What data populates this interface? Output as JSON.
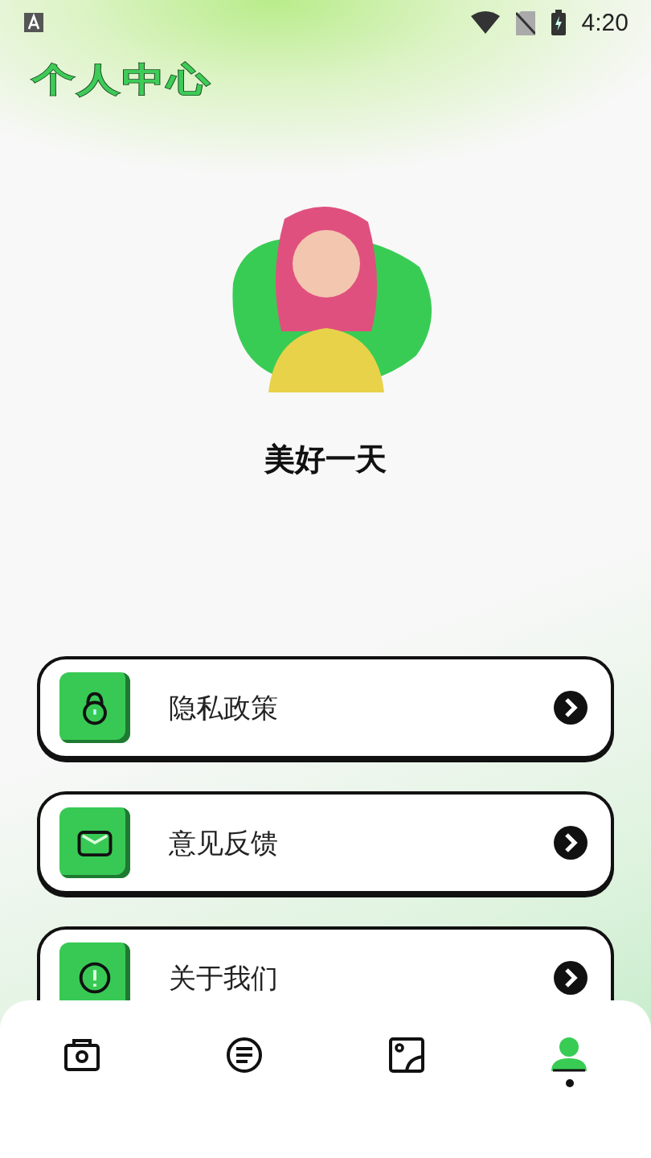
{
  "status_bar": {
    "time": "4:20"
  },
  "title": "个人中心",
  "profile": {
    "name": "美好一天"
  },
  "menu": [
    {
      "kind": "lock",
      "label": "隐私政策"
    },
    {
      "kind": "mail",
      "label": "意见反馈"
    },
    {
      "kind": "info",
      "label": "关于我们"
    }
  ],
  "nav": [
    {
      "kind": "camera",
      "selected": false
    },
    {
      "kind": "list",
      "selected": false
    },
    {
      "kind": "picture",
      "selected": false
    },
    {
      "kind": "person",
      "selected": true
    }
  ]
}
